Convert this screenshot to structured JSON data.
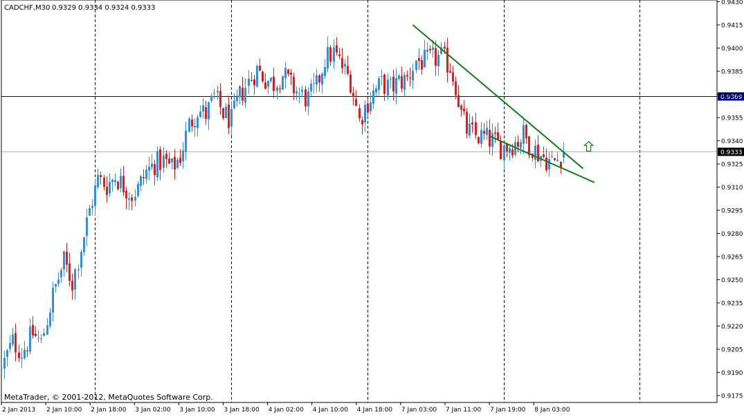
{
  "window": {
    "symbol_header": "CADCHF,M30",
    "ohlc_header": "0.9329 0.9334 0.9324 0.9333",
    "copyright": "MetaTrader, © 2001-2012, MetaQuotes Software Corp."
  },
  "colors": {
    "bull": "#2f8fe6",
    "bear": "#e61a1a",
    "trendline": "#0f7f12",
    "hline": "#000080",
    "current_line": "#b0b0b0",
    "arrow": "#0f7f12"
  },
  "chart_data": {
    "type": "candlestick",
    "symbol": "CADCHF",
    "timeframe": "M30",
    "ylim": [
      0.9168,
      0.943
    ],
    "y_ticks": [
      "0.9430",
      "0.9415",
      "0.9400",
      "0.9385",
      "0.9370",
      "0.9355",
      "0.9340",
      "0.9325",
      "0.9310",
      "0.9295",
      "0.9280",
      "0.9265",
      "0.9250",
      "0.9235",
      "0.9220",
      "0.9205",
      "0.9190",
      "0.9175"
    ],
    "x_ticks": [
      "2 Jan 2013",
      "2 Jan 10:00",
      "2 Jan 18:00",
      "3 Jan 02:00",
      "3 Jan 10:00",
      "3 Jan 18:00",
      "4 Jan 02:00",
      "4 Jan 10:00",
      "4 Jan 18:00",
      "7 Jan 03:00",
      "7 Jan 11:00",
      "7 Jan 19:00",
      "8 Jan 03:00"
    ],
    "session_separators": [
      "2 Jan 16:00",
      "3 Jan 16:00",
      "4 Jan 16:00",
      "7 Jan 16:00",
      "8 Jan 16:00"
    ],
    "last_price": "0.9333",
    "horizontal_line_level": "0.9369",
    "trendlines": [
      {
        "name": "upper",
        "from": {
          "time": "7 Jan 00:00",
          "price": 0.9415
        },
        "to": {
          "time": "8 Jan 06:00",
          "price": 0.9322
        }
      },
      {
        "name": "lower",
        "from": {
          "time": "7 Jan 13:30",
          "price": 0.9343
        },
        "to": {
          "time": "8 Jan 08:00",
          "price": 0.9313
        }
      }
    ],
    "annotation": {
      "type": "arrow-up",
      "time": "8 Jan 07:00",
      "price": 0.9336
    },
    "close_path": [
      [
        0,
        0.9197
      ],
      [
        3,
        0.921
      ],
      [
        6,
        0.9203
      ],
      [
        10,
        0.9215
      ],
      [
        13,
        0.9209
      ],
      [
        17,
        0.924
      ],
      [
        21,
        0.9262
      ],
      [
        24,
        0.9248
      ],
      [
        27,
        0.9271
      ],
      [
        30,
        0.9295
      ],
      [
        33,
        0.9315
      ],
      [
        36,
        0.9311
      ],
      [
        39,
        0.9317
      ],
      [
        42,
        0.9311
      ],
      [
        45,
        0.9305
      ],
      [
        47,
        0.9309
      ],
      [
        50,
        0.932
      ],
      [
        53,
        0.9325
      ],
      [
        56,
        0.9327
      ],
      [
        59,
        0.9322
      ],
      [
        62,
        0.933
      ],
      [
        65,
        0.935
      ],
      [
        68,
        0.936
      ],
      [
        71,
        0.9357
      ],
      [
        74,
        0.9368
      ],
      [
        77,
        0.9358
      ],
      [
        80,
        0.9353
      ],
      [
        83,
        0.9369
      ],
      [
        86,
        0.9378
      ],
      [
        89,
        0.9386
      ],
      [
        92,
        0.938
      ],
      [
        95,
        0.9377
      ],
      [
        98,
        0.9383
      ],
      [
        101,
        0.9376
      ],
      [
        104,
        0.937
      ],
      [
        107,
        0.9367
      ],
      [
        110,
        0.9375
      ],
      [
        113,
        0.9393
      ],
      [
        116,
        0.9397
      ],
      [
        119,
        0.9388
      ],
      [
        122,
        0.9379
      ],
      [
        124,
        0.9362
      ],
      [
        125,
        0.9353
      ],
      [
        127,
        0.9362
      ],
      [
        130,
        0.9371
      ],
      [
        133,
        0.9377
      ],
      [
        136,
        0.9374
      ],
      [
        139,
        0.9378
      ],
      [
        142,
        0.938
      ],
      [
        145,
        0.9392
      ],
      [
        148,
        0.9391
      ],
      [
        151,
        0.9393
      ],
      [
        154,
        0.9394
      ],
      [
        157,
        0.9388
      ],
      [
        159,
        0.9376
      ],
      [
        161,
        0.9357
      ],
      [
        163,
        0.9347
      ],
      [
        166,
        0.9343
      ],
      [
        169,
        0.9342
      ],
      [
        172,
        0.934
      ],
      [
        175,
        0.9336
      ],
      [
        178,
        0.9337
      ],
      [
        181,
        0.934
      ],
      [
        183,
        0.9344
      ],
      [
        185,
        0.9338
      ],
      [
        188,
        0.9332
      ],
      [
        191,
        0.9328
      ],
      [
        193,
        0.9326
      ],
      [
        195,
        0.9328
      ],
      [
        197,
        0.9333
      ]
    ]
  }
}
